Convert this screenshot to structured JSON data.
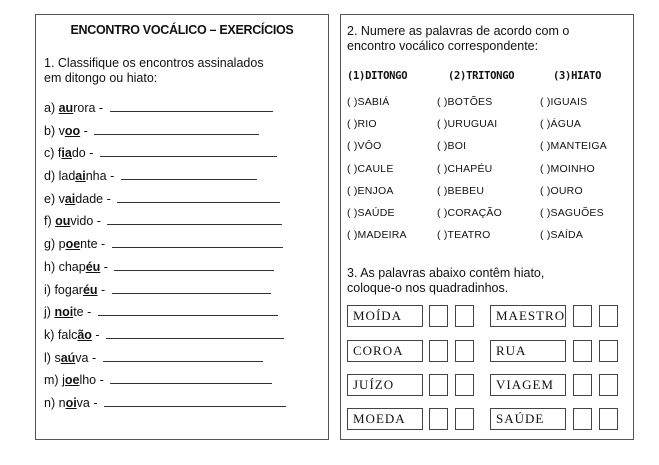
{
  "left_panel": {
    "title": "ENCONTRO VOCÁLICO – EXERCÍCIOS",
    "instruction_line1": "1. Classifique os encontros assinalados",
    "instruction_line2": "em ditongo ou hiato:",
    "items": [
      {
        "label": "a)",
        "pre": "",
        "mark": "au",
        "post": "rora -"
      },
      {
        "label": "b)",
        "pre": "v",
        "mark": "oo",
        "post": " -"
      },
      {
        "label": "c)",
        "pre": "f",
        "mark": "ia",
        "post": "do -"
      },
      {
        "label": "d)",
        "pre": "lad",
        "mark": "ai",
        "post": "nha -"
      },
      {
        "label": "e)",
        "pre": "v",
        "mark": "ai",
        "post": "dade -"
      },
      {
        "label": "f)",
        "pre": "",
        "mark": "ou",
        "post": "vido -"
      },
      {
        "label": "g)",
        "pre": "p",
        "mark": "oe",
        "post": "nte -"
      },
      {
        "label": "h)",
        "pre": "chap",
        "mark": "éu",
        "post": " -"
      },
      {
        "label": "i)",
        "pre": "fogar",
        "mark": "éu",
        "post": " -"
      },
      {
        "label": "j)",
        "pre": "",
        "mark": "noi",
        "post": "te -"
      },
      {
        "label": "k)",
        "pre": "falc",
        "mark": "ão",
        "post": " -"
      },
      {
        "label": "l)",
        "pre": "s",
        "mark": "aú",
        "post": "va -"
      },
      {
        "label": "m)",
        "pre": "j",
        "mark": "oe",
        "post": "lho -"
      },
      {
        "label": "n)",
        "pre": "n",
        "mark": "oi",
        "post": "va -"
      }
    ]
  },
  "right_panel": {
    "instruction2_line1": "2. Numere as palavras de acordo com o",
    "instruction2_line2": "encontro vocálico correspondente:",
    "headers": [
      "(1)DITONGO",
      "(2)TRITONGO",
      "(3)HIATO"
    ],
    "columns": [
      [
        "( )SABIÁ",
        "( )RIO",
        "( )VÔO",
        "( )CAULE",
        "( )ENJOA",
        "( )SAÚDE",
        "( )MADEIRA"
      ],
      [
        "( )BOTÕES",
        "( )URUGUAI",
        "( )BOI",
        "( )CHAPÉU",
        "( )BEBEU",
        "( )CORAÇÃO",
        "( )TEATRO"
      ],
      [
        "( )IGUAIS",
        "( )ÁGUA",
        "( )MANTEIGA",
        "( )MOINHO",
        "( )OURO",
        "( )SAGUÕES",
        "( )SAÍDA"
      ]
    ],
    "instruction3_line1": "3. As palavras abaixo contêm hiato,",
    "instruction3_line2": "coloque-o nos quadradinhos.",
    "words_left": [
      "MOÍDA",
      "COROA",
      "JUÍZO",
      "MOEDA"
    ],
    "words_right": [
      "MAESTRO",
      "RUA",
      "VIAGEM",
      "SAÚDE"
    ]
  }
}
